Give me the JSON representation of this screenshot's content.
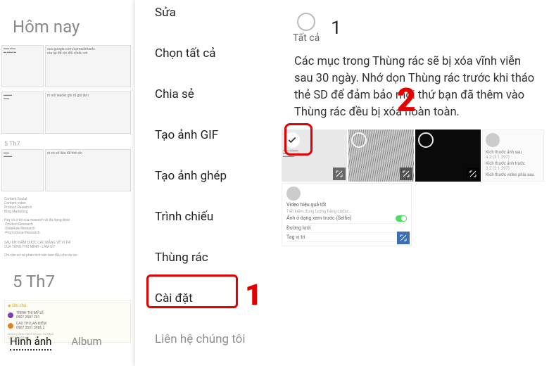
{
  "left": {
    "today": "Hôm nay",
    "thumb_texts": {
      "sheet_url": "ocs.google.com/spreadsheets",
      "note1": "ote lại để chị đối chiếu với",
      "note2": "m nói leader ghi rõ giờ làm",
      "note3": "ơi có số liệu để tính dc"
    },
    "date_sep": "5 Th7",
    "date2": "5 Th7",
    "tabs": {
      "images": "Hình ảnh",
      "album": "Album"
    }
  },
  "menu": {
    "edit": "Sửa",
    "select_all": "Chọn tất cả",
    "share": "Chia sẻ",
    "create_gif": "Tạo ảnh GIF",
    "create_collage": "Tạo ảnh ghép",
    "slideshow": "Trình chiếu",
    "trash": "Thùng rác",
    "settings": "Cài đặt",
    "contact": "Liên hệ chúng tôi"
  },
  "right": {
    "select_all": "Tất cả",
    "count": "1",
    "info": "Các mục trong Thùng rác sẽ bị xóa vĩnh viễn sau 30 ngày. Nhớ dọn Thùng rác trước khi tháo thẻ SD để đảm bảo mọi thứ bạn đã thêm vào Thùng rác đều bị xóa hoàn toàn.",
    "size_labels": {
      "a": "Kích thước ảnh sau",
      "b": "Kích thước ảnh trước",
      "c": "Kích thước video phía sau"
    },
    "settings_panel": {
      "heading": "Video hiệu quả tốt",
      "selfie": "Ảnh ở dạng xem trước (Selfie)",
      "line": "Đường lưới",
      "tag": "Tag vị trí"
    }
  },
  "annotations": {
    "one": "1",
    "two": "2"
  }
}
